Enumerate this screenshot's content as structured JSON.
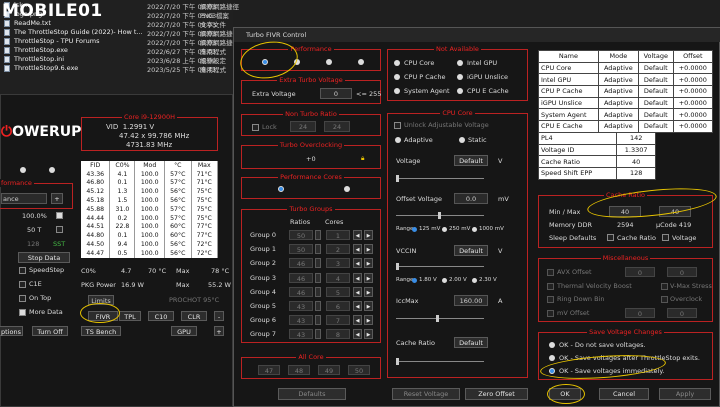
{
  "explorer": {
    "files": [
      {
        "name": "lsk-...",
        "date": "2022/7/20 下午 05:03",
        "type": "網際網路捷徑",
        "size": "1 KB"
      },
      {
        "name": "logo.png",
        "date": "2022/7/20 下午 05:03",
        "type": "PNG 檔案",
        "size": "13 KB"
      },
      {
        "name": "ReadMe.txt",
        "date": "2022/7/20 下午 05:03",
        "type": "文字文件",
        "size": "5 KB"
      },
      {
        "name": "The ThrottleStop Guide (2022)- How t...",
        "date": "2022/7/20 下午 05:03",
        "type": "網際網路捷徑",
        "size": "1 KB"
      },
      {
        "name": "ThrottleStop - TPU Forums",
        "date": "2022/7/20 下午 05:03",
        "type": "網際網路捷徑",
        "size": "1 KB"
      },
      {
        "name": "ThrottleStop.exe",
        "date": "2022/6/27 下午 05:03",
        "type": "應用程式",
        "size": "1,104 KB"
      },
      {
        "name": "ThrottleStop.ini",
        "date": "2023/6/28 上午 05:09",
        "type": "組態設定",
        "size": "9 KB"
      },
      {
        "name": "ThrottleStop9.6.exe",
        "date": "2023/5/25 下午 08:43",
        "type": "應用程式",
        "size": ""
      }
    ]
  },
  "watermark": "MOBILE01",
  "throttlestop": {
    "logo": "OWERUP",
    "core_id": "Core i9-12900H",
    "vid_label": "VID",
    "vid": "1.2991 V",
    "freq": "47.42 x 99.786 MHz",
    "freq_mhz": "4731.83 MHz",
    "perf_label": "formance",
    "profile_select": "ance",
    "pct": "100.0%",
    "tdp": "50 T",
    "num": "128",
    "sst": "SST",
    "stop_data": "Stop Data",
    "checks": [
      {
        "label": "SpeedStep",
        "checked": false
      },
      {
        "label": "C1E",
        "checked": false
      },
      {
        "label": "On Top",
        "checked": false
      },
      {
        "label": "More Data",
        "checked": true
      }
    ],
    "cols": [
      "FID",
      "C0%",
      "Mod",
      "°C",
      "Max"
    ],
    "rows": [
      [
        "43.36",
        "4.1",
        "100.0",
        "57°C",
        "71°C"
      ],
      [
        "46.80",
        "0.1",
        "100.0",
        "57°C",
        "71°C"
      ],
      [
        "45.12",
        "1.3",
        "100.0",
        "56°C",
        "75°C"
      ],
      [
        "45.18",
        "1.5",
        "100.0",
        "56°C",
        "75°C"
      ],
      [
        "45.88",
        "31.0",
        "100.0",
        "57°C",
        "75°C"
      ],
      [
        "44.44",
        "0.2",
        "100.0",
        "57°C",
        "75°C"
      ],
      [
        "44.51",
        "22.8",
        "100.0",
        "60°C",
        "77°C"
      ],
      [
        "44.80",
        "0.1",
        "100.0",
        "60°C",
        "77°C"
      ],
      [
        "44.50",
        "9.4",
        "100.0",
        "56°C",
        "72°C"
      ],
      [
        "44.47",
        "0.5",
        "100.0",
        "56°C",
        "72°C"
      ]
    ],
    "summary1": [
      "C0%",
      "4.7",
      "70 °C",
      "Max",
      "78 °C"
    ],
    "summary2": [
      "PKG Power",
      "16.9 W",
      "Max",
      "55.2 W"
    ],
    "prochot": "PROCHOT 95°C",
    "limits": "Limits",
    "buttons_row1": [
      "FIVR",
      "TPL",
      "C10",
      "CLR",
      "-"
    ],
    "buttons_row2": [
      "ptions",
      "Turn Off",
      "TS Bench",
      "GPU",
      "+"
    ]
  },
  "fivr": {
    "title": "Turbo FIVR Control",
    "performance": "Performance",
    "extra_turbo": "Extra Turbo Voltage",
    "extra_voltage_label": "Extra Voltage",
    "extra_voltage_val": "0",
    "extra_voltage_unit": "<= 255",
    "non_turbo": "Non Turbo Ratio",
    "lock": "Lock",
    "nt_val1": "24",
    "nt_val2": "24",
    "turbo_oc": "Turbo Overclocking",
    "oc_val": "+0",
    "perf_cores": "Performance Cores",
    "turbo_groups": "Turbo Groups",
    "ratios_hdr": "Ratios",
    "cores_hdr": "Cores",
    "groups": [
      {
        "name": "Group 0",
        "ratio": "50",
        "cores": "1"
      },
      {
        "name": "Group 1",
        "ratio": "50",
        "cores": "2"
      },
      {
        "name": "Group 2",
        "ratio": "46",
        "cores": "3"
      },
      {
        "name": "Group 3",
        "ratio": "46",
        "cores": "4"
      },
      {
        "name": "Group 4",
        "ratio": "46",
        "cores": "5"
      },
      {
        "name": "Group 5",
        "ratio": "43",
        "cores": "6"
      },
      {
        "name": "Group 6",
        "ratio": "43",
        "cores": "7"
      },
      {
        "name": "Group 7",
        "ratio": "43",
        "cores": "8"
      }
    ],
    "all_core": "All Core",
    "all_core_vals": [
      "47",
      "48",
      "49",
      "50"
    ],
    "defaults": "Defaults",
    "not_available": "Not Available",
    "domains": [
      "CPU Core",
      "Intel GPU",
      "CPU P Cache",
      "iGPU Unslice",
      "System Agent",
      "CPU E Cache"
    ],
    "cpu_core": "CPU Core",
    "unlock_voltage": "Unlock Adjustable Voltage",
    "adaptive": "Adaptive",
    "static": "Static",
    "voltage_label": "Voltage",
    "voltage_mode": "Default",
    "voltage_unit": "V",
    "offset_label": "Offset Voltage",
    "offset_val": "0.0",
    "offset_unit": "mV",
    "range_label": "Range",
    "range_opts": [
      "125 mV",
      "250 mV",
      "1000 mV"
    ],
    "vccin_label": "VCCIN",
    "vccin_mode": "Default",
    "vccin_unit": "V",
    "vccin_range": [
      "1.80 V",
      "2.00 V",
      "2.30 V"
    ],
    "iccmax_label": "IccMax",
    "iccmax_val": "160.00",
    "iccmax_unit": "A",
    "cache_ratio_label": "Cache Ratio",
    "cache_ratio_mode": "Default",
    "reset_voltage": "Reset Voltage",
    "zero_offset": "Zero Offset",
    "table_hdr": [
      "Name",
      "Mode",
      "Voltage",
      "Offset"
    ],
    "table_rows": [
      [
        "CPU Core",
        "Adaptive",
        "Default",
        "+0.0000"
      ],
      [
        "Intel GPU",
        "Adaptive",
        "Default",
        "+0.0000"
      ],
      [
        "CPU P Cache",
        "Adaptive",
        "Default",
        "+0.0000"
      ],
      [
        "iGPU Unslice",
        "Adaptive",
        "Default",
        "+0.0000"
      ],
      [
        "System Agent",
        "Adaptive",
        "Default",
        "+0.0000"
      ],
      [
        "CPU E Cache",
        "Adaptive",
        "Default",
        "+0.0000"
      ]
    ],
    "info_rows": [
      [
        "PL4",
        "142"
      ],
      [
        "Voltage ID",
        "1.3307"
      ],
      [
        "Cache Ratio",
        "40"
      ],
      [
        "Speed Shift EPP",
        "128"
      ]
    ],
    "cache_ratio_group": "Cache Ratio",
    "minmax_label": "Min / Max",
    "min_val": "40",
    "max_val": "40",
    "memory_label": "Memory DDR",
    "memory_val": "2594",
    "ucode_val": "µCode 419",
    "sleep_label": "Sleep Defaults",
    "cache_ratio_chk": "Cache Ratio",
    "voltage_chk": "Voltage",
    "misc": "Miscellaneous",
    "misc_items": [
      {
        "label": "AVX Offset",
        "val": "0",
        "extra": "0"
      },
      {
        "label": "Thermal Velocity Boost",
        "extra": "V-Max Stress"
      },
      {
        "label": "Ring Down Bin",
        "extra": "Overclock"
      },
      {
        "label": "mV Offset",
        "val": "0",
        "extra": "0"
      }
    ],
    "save_group": "Save Voltage Changes",
    "save_opts": [
      "OK - Do not save voltages.",
      "OK - Save voltages after ThrottleStop exits.",
      "OK - Save voltages immediately."
    ],
    "ok": "OK",
    "cancel": "Cancel",
    "apply": "Apply"
  }
}
